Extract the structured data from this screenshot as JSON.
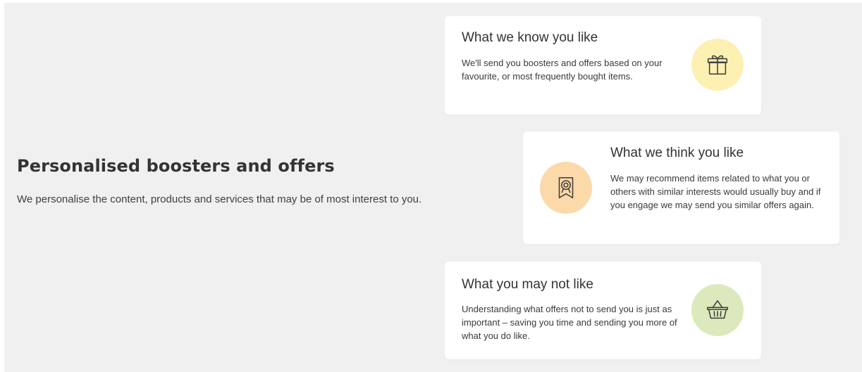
{
  "intro": {
    "title": "Personalised boosters and offers",
    "body": "We personalise the content, products and services that may be of most interest to you."
  },
  "cards": [
    {
      "title": "What we know you like",
      "description": "We'll send you boosters and offers based on your favourite, or most frequently bought items.",
      "icon": "gift-icon",
      "icon_bg": "#fdf0b3"
    },
    {
      "title": "What we think you like",
      "description": "We may recommend items related to what you or others with similar interests would usually buy and if you engage we may send you similar offers again.",
      "icon": "award-ribbon-icon",
      "icon_bg": "#fcd9a8"
    },
    {
      "title": "What you may not like",
      "description": "Understanding what offers not to send you is just as important – saving you time and sending you more of what you do like.",
      "icon": "basket-icon",
      "icon_bg": "#dbe9bd"
    }
  ],
  "colors": {
    "background": "#f0f0f0",
    "card": "#ffffff",
    "text": "#333333"
  }
}
